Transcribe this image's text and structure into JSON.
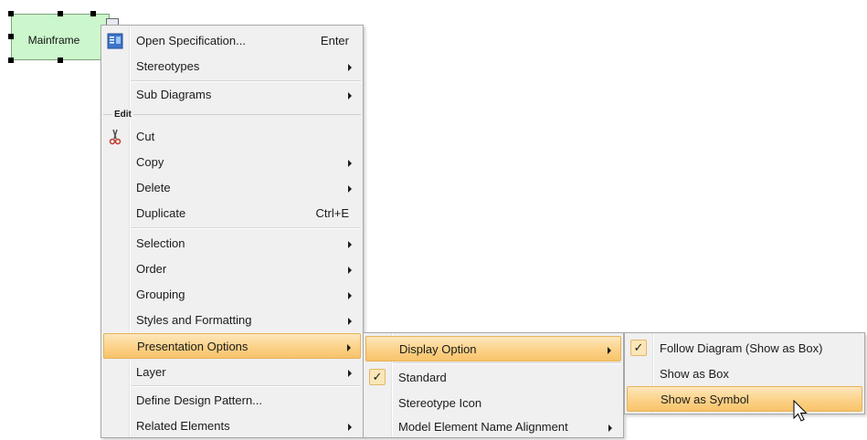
{
  "diagram": {
    "element_label": "Mainframe"
  },
  "context_menu": {
    "items": [
      {
        "label": "Open Specification...",
        "shortcut": "Enter",
        "icon": "specification-icon"
      },
      {
        "label": "Stereotypes"
      },
      {
        "label": "Sub Diagrams"
      },
      {
        "label": "Cut",
        "icon": "scissors-icon"
      },
      {
        "label": "Copy"
      },
      {
        "label": "Delete"
      },
      {
        "label": "Duplicate",
        "shortcut": "Ctrl+E"
      },
      {
        "label": "Selection"
      },
      {
        "label": "Order"
      },
      {
        "label": "Grouping"
      },
      {
        "label": "Styles and Formatting"
      },
      {
        "label": "Presentation Options",
        "state": "highlighted"
      },
      {
        "label": "Layer"
      },
      {
        "label": "Define Design Pattern..."
      },
      {
        "label": "Related Elements"
      }
    ],
    "group_edit_label": "Edit"
  },
  "presentation_submenu": {
    "items": [
      {
        "label": "Display Option",
        "state": "highlighted"
      },
      {
        "label": "Standard",
        "checked": true
      },
      {
        "label": "Stereotype Icon"
      },
      {
        "label": "Model Element Name Alignment"
      }
    ]
  },
  "display_submenu": {
    "items": [
      {
        "label": "Follow Diagram (Show as Box)",
        "checked": true
      },
      {
        "label": "Show as Box"
      },
      {
        "label": "Show as Symbol",
        "state": "highlighted"
      }
    ]
  },
  "colors": {
    "highlight": "#fcd48c",
    "element_fill": "#ccf7cc",
    "menu_bg": "#f0f0f0"
  }
}
